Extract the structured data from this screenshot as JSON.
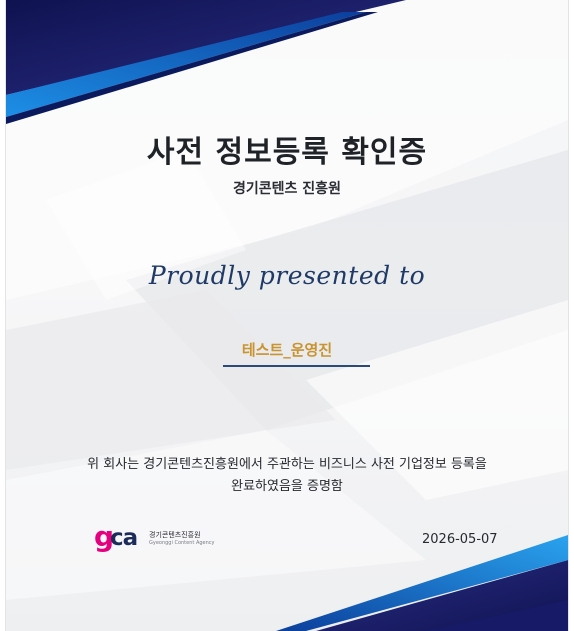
{
  "certificate": {
    "title": "사전 정보등록 확인증",
    "organization": "경기콘텐츠 진흥원",
    "presented_to": "Proudly presented to",
    "recipient": "테스트_운영진",
    "body_line1": "위 회사는 경기콘텐츠진흥원에서 주관하는 비즈니스 사전 기업정보 등록을",
    "body_line2": "완료하였음을 증명함",
    "date": "2026-05-07"
  },
  "logo": {
    "mark_g": "g",
    "mark_ca": "ca",
    "name_kr": "경기콘텐츠진흥원",
    "name_en": "Gyeonggi Content Agency"
  },
  "colors": {
    "navy": "#1a1f6e",
    "blue_accent": "#2a8be0",
    "recipient_gold": "#c9932f",
    "logo_pink": "#e4007f"
  }
}
